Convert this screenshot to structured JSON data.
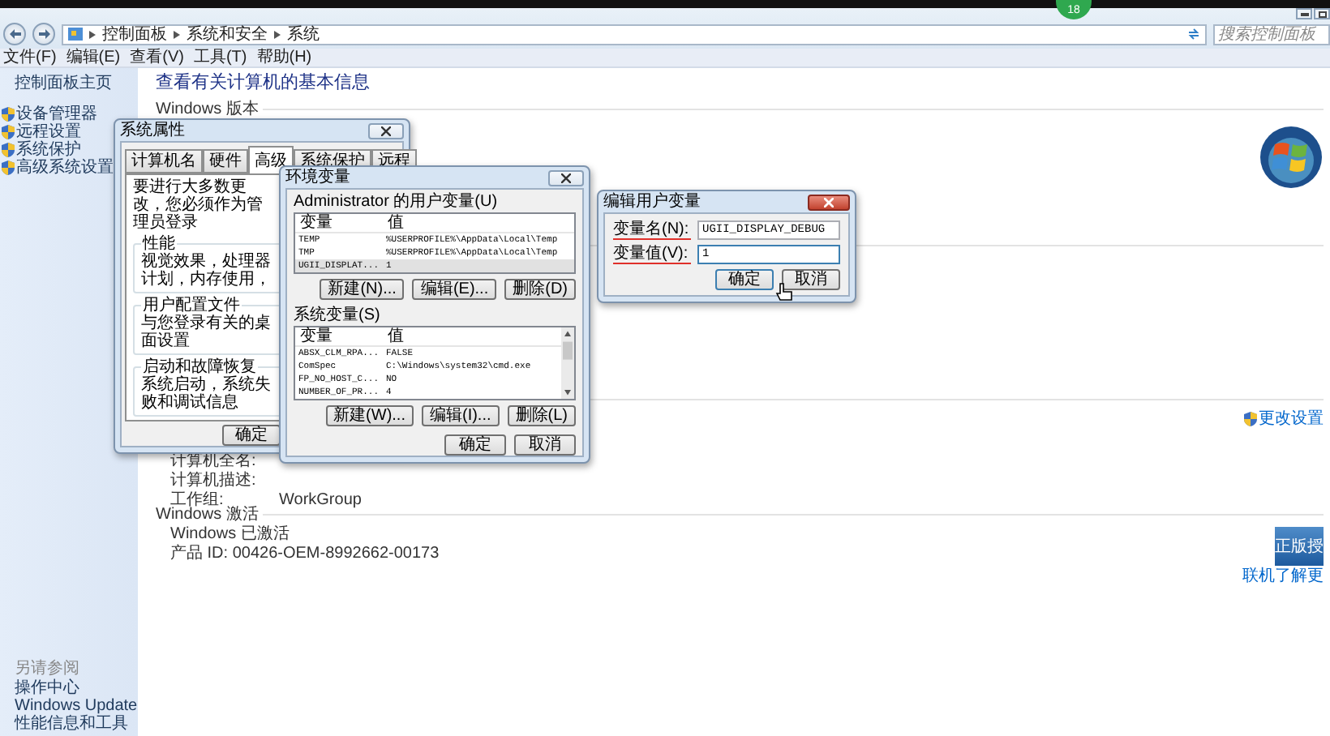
{
  "top_badge": "18",
  "explorer": {
    "breadcrumb": [
      "控制面板",
      "系统和安全",
      "系统"
    ],
    "search": {
      "placeholder": "搜索控制面板"
    },
    "menu": [
      "文件(F)",
      "编辑(E)",
      "查看(V)",
      "工具(T)",
      "帮助(H)"
    ]
  },
  "sidebar": {
    "items": [
      {
        "label": "控制面板主页",
        "kind": "home"
      },
      {
        "label": "设备管理器",
        "kind": "shield"
      },
      {
        "label": "远程设置",
        "kind": "shield"
      },
      {
        "label": "系统保护",
        "kind": "shield"
      },
      {
        "label": "高级系统设置",
        "kind": "shield"
      }
    ],
    "see_also": {
      "title": "另请参阅",
      "items": [
        "操作中心",
        "Windows Update",
        "性能信息和工具"
      ]
    }
  },
  "main": {
    "heading": "查看有关计算机的基本信息",
    "sections": [
      {
        "kind": "edition",
        "title": "Windows 版本"
      },
      {
        "kind": "blank"
      },
      {
        "kind": "computer",
        "link": "更改设置",
        "rows": [
          {
            "label": "计算机全名:"
          },
          {
            "label": "计算机描述:"
          },
          {
            "label": "工作组:",
            "value": "WorkGroup"
          }
        ]
      },
      {
        "kind": "activation",
        "title": "Windows 激活",
        "rows": [
          {
            "label": "Windows 已激活"
          },
          {
            "label": "产品 ID: 00426-OEM-8992662-00173"
          }
        ],
        "badge": {
          "title": "正版授",
          "link": "联机了解更"
        }
      }
    ]
  },
  "dialogs": {
    "system_properties": {
      "title": "系统属性",
      "tabs": [
        {
          "label": "计算机名",
          "selected": false
        },
        {
          "label": "硬件",
          "selected": false
        },
        {
          "label": "高级",
          "selected": true
        },
        {
          "label": "系统保护",
          "selected": false
        },
        {
          "label": "远程",
          "selected": false
        }
      ],
      "notice": "要进行大多数更改，您必须作为管理员登录",
      "groups": [
        {
          "title": "性能",
          "text": "视觉效果，处理器计划，内存使用，"
        },
        {
          "title": "用户配置文件",
          "text": "与您登录有关的桌面设置"
        },
        {
          "title": "启动和故障恢复",
          "text": "系统启动，系统失败和调试信息"
        }
      ],
      "ok": "确定"
    },
    "environment": {
      "title": "环境变量",
      "user": {
        "title": "Administrator 的用户变量(U)",
        "columns": [
          "变量",
          "值"
        ],
        "rows": [
          {
            "name": "TEMP",
            "value": "%USERPROFILE%\\AppData\\Local\\Temp",
            "selected": false
          },
          {
            "name": "TMP",
            "value": "%USERPROFILE%\\AppData\\Local\\Temp",
            "selected": false
          },
          {
            "name": "UGII_DISPLAT...",
            "value": "1",
            "selected": true
          }
        ],
        "buttons": [
          "新建(N)...",
          "编辑(E)...",
          "删除(D)"
        ]
      },
      "system": {
        "title": "系统变量(S)",
        "columns": [
          "变量",
          "值"
        ],
        "rows": [
          {
            "name": "ABSX_CLM_RPA...",
            "value": "FALSE",
            "selected": false
          },
          {
            "name": "ComSpec",
            "value": "C:\\Windows\\system32\\cmd.exe",
            "selected": false
          },
          {
            "name": "FP_NO_HOST_C...",
            "value": "NO",
            "selected": false
          },
          {
            "name": "NUMBER_OF_PR...",
            "value": "4",
            "selected": false
          }
        ],
        "buttons": [
          "新建(W)...",
          "编辑(I)...",
          "删除(L)"
        ]
      },
      "ok": "确定",
      "cancel": "取消"
    },
    "edit_variable": {
      "title": "编辑用户变量",
      "name_label": "变量名(N):",
      "name_value": "UGII_DISPLAY_DEBUG",
      "value_label": "变量值(V):",
      "value": "1",
      "ok": "确定",
      "cancel": "取消"
    }
  }
}
